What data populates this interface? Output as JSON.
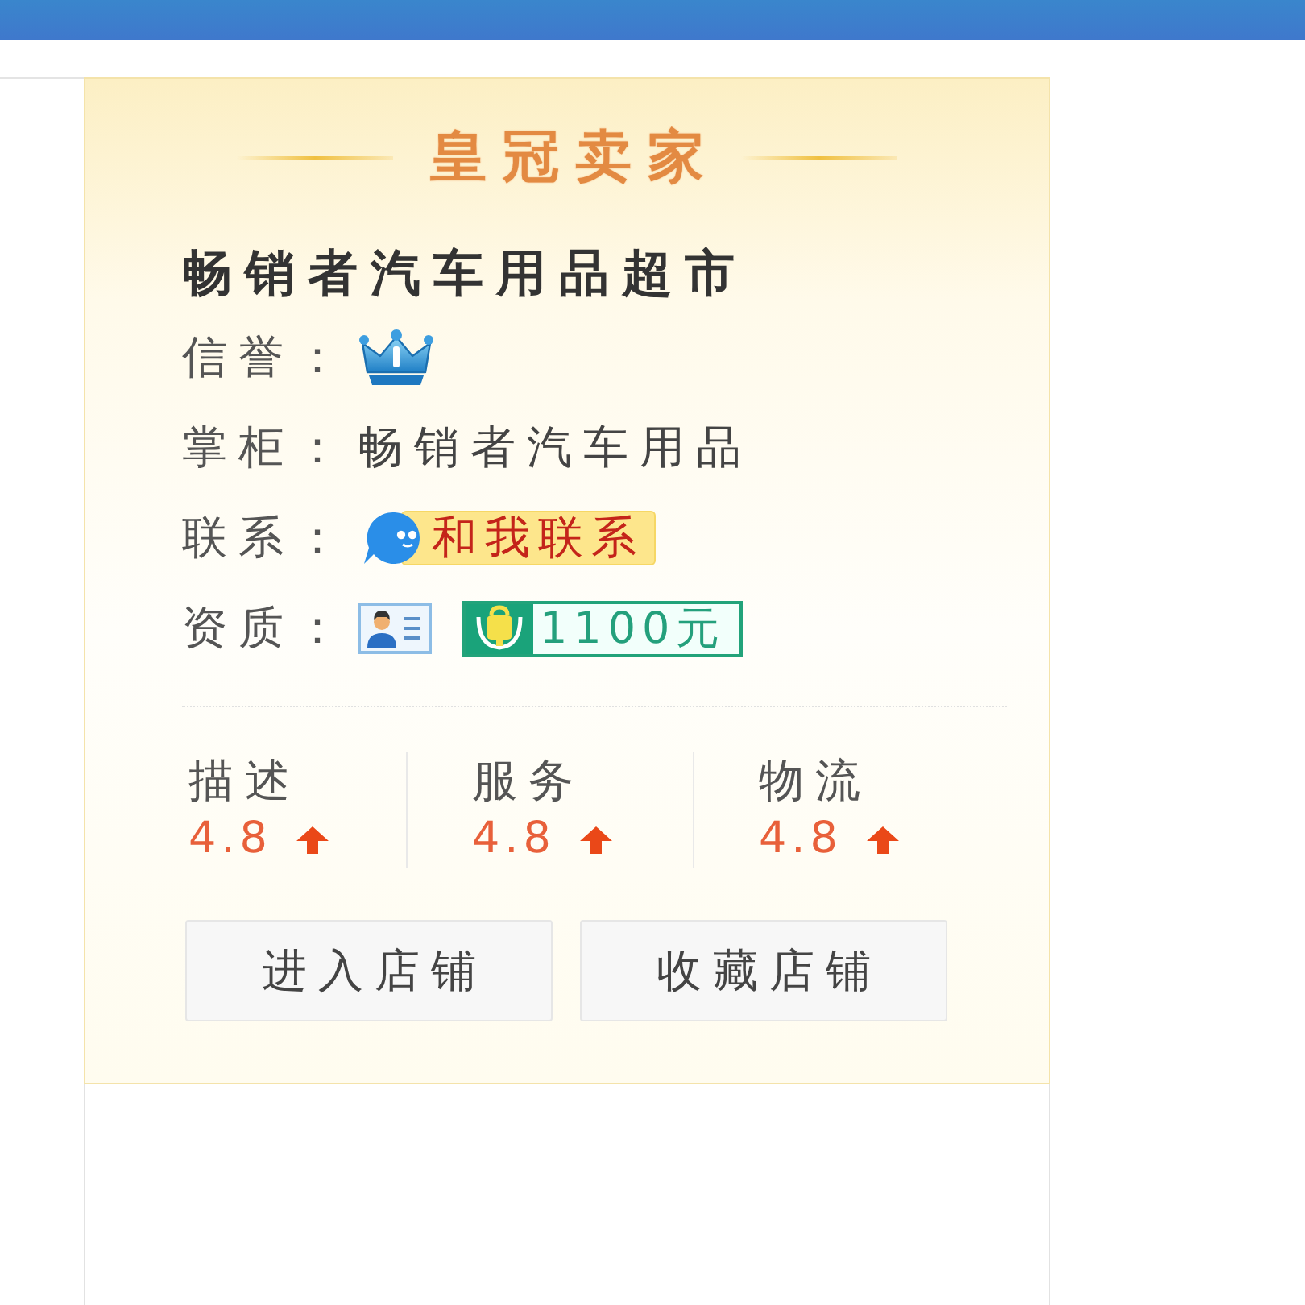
{
  "seller_card": {
    "title": "皇冠卖家",
    "shop_name": "畅销者汽车用品超市",
    "info_rows": [
      {
        "kind": "credit",
        "label": "信誉："
      },
      {
        "kind": "text",
        "label": "掌柜：",
        "value": "畅销者汽车用品"
      },
      {
        "kind": "contact",
        "label": "联系：",
        "button": "和我联系"
      },
      {
        "kind": "qualification",
        "label": "资质：",
        "deposit": "1100元"
      }
    ],
    "ratings": [
      {
        "label": "描述",
        "score": "4.8",
        "rising": true
      },
      {
        "label": "服务",
        "score": "4.8",
        "rising": true
      },
      {
        "label": "物流",
        "score": "4.8",
        "rising": true
      }
    ],
    "buttons": [
      {
        "label": "进入店铺"
      },
      {
        "label": "收藏店铺"
      }
    ]
  }
}
